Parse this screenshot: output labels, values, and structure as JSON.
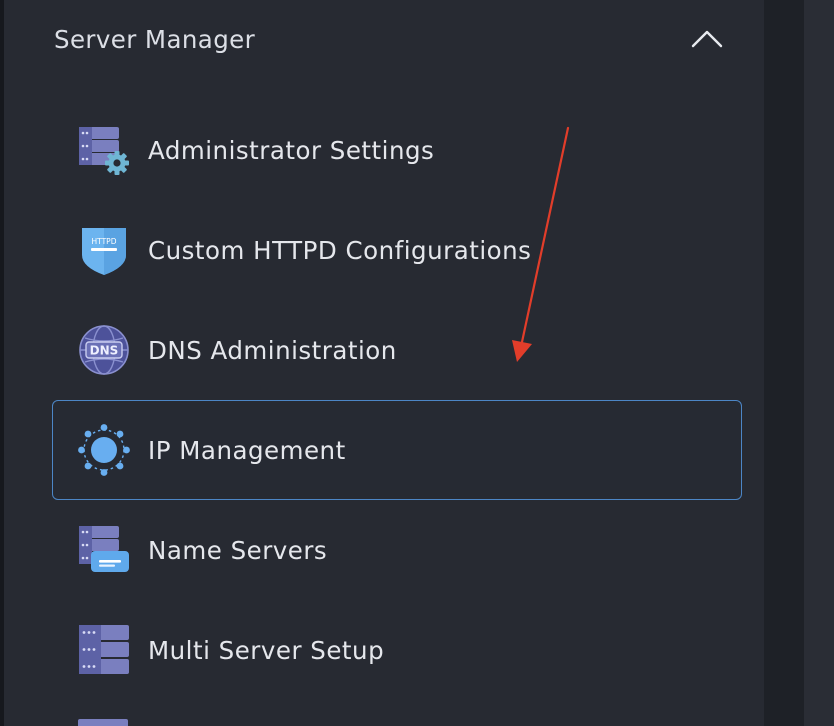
{
  "section": {
    "title": "Server Manager",
    "expanded": true
  },
  "menu": {
    "items": [
      {
        "label": "Administrator Settings",
        "icon": "server-gear-icon"
      },
      {
        "label": "Custom HTTPD Configurations",
        "icon": "httpd-shield-icon",
        "badge": "HTTPD"
      },
      {
        "label": "DNS Administration",
        "icon": "dns-globe-icon",
        "badge": "DNS"
      },
      {
        "label": "IP Management",
        "icon": "network-node-icon",
        "selected": true
      },
      {
        "label": "Name Servers",
        "icon": "server-message-icon"
      },
      {
        "label": "Multi Server Setup",
        "icon": "server-stack-icon"
      }
    ]
  },
  "colors": {
    "panel": "#272a32",
    "active_border": "#4c86c6",
    "icon_purple": "#7a7fbf",
    "icon_blue": "#68aef0",
    "annotation_arrow": "#e23d2a"
  }
}
